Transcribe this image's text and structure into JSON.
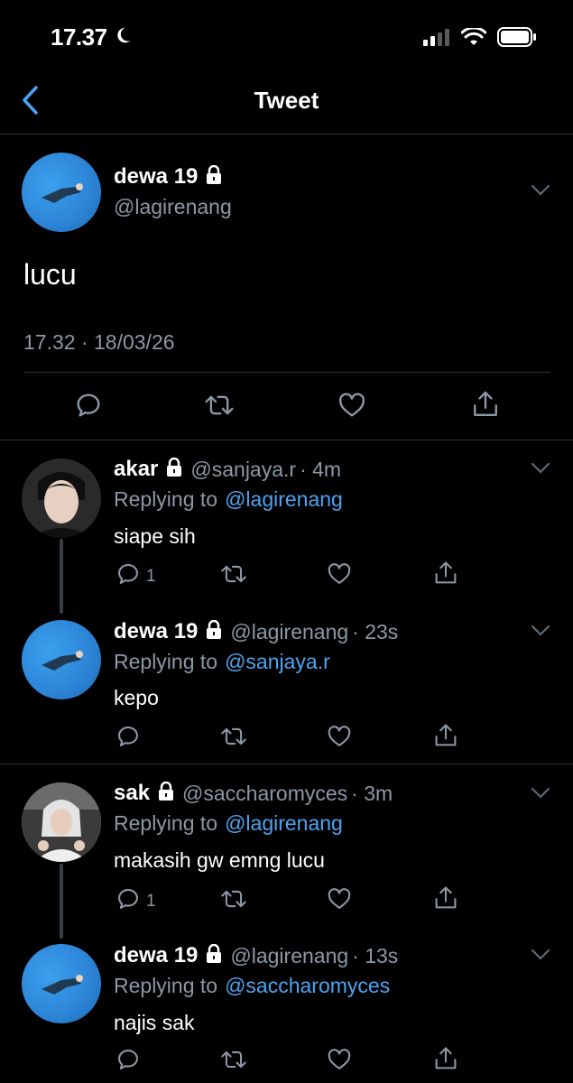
{
  "status": {
    "time": "17.37"
  },
  "header": {
    "title": "Tweet"
  },
  "main_tweet": {
    "name": "dewa 19",
    "handle": "@lagirenang",
    "text": "lucu",
    "timestamp": "17.32 · 18/03/26"
  },
  "replies": [
    {
      "name": "akar",
      "handle": "@sanjaya.r",
      "time": "· 4m",
      "replying_prefix": "Replying to",
      "replying_to": "@lagirenang",
      "text": "siape sih",
      "reply_count": "1"
    },
    {
      "name": "dewa 19",
      "handle": "@lagirenang",
      "time": "· 23s",
      "replying_prefix": "Replying to",
      "replying_to": "@sanjaya.r",
      "text": "kepo",
      "reply_count": ""
    },
    {
      "name": "sak",
      "handle": "@saccharomyces",
      "time": "· 3m",
      "replying_prefix": "Replying to",
      "replying_to": "@lagirenang",
      "text": "makasih gw emng lucu",
      "reply_count": "1"
    },
    {
      "name": "dewa 19",
      "handle": "@lagirenang",
      "time": "· 13s",
      "replying_prefix": "Replying to",
      "replying_to": "@saccharomyces",
      "text": "najis sak",
      "reply_count": ""
    }
  ],
  "icons": [
    "moon-icon",
    "signal-icon",
    "wifi-icon",
    "battery-icon",
    "back-chevron-icon",
    "lock-icon",
    "chevron-down-icon",
    "reply-icon",
    "retweet-icon",
    "like-icon",
    "share-icon"
  ],
  "colors": {
    "background": "#000000",
    "accent": "#4ea3f0",
    "muted": "#8b98a5",
    "divider": "#2f3336"
  }
}
